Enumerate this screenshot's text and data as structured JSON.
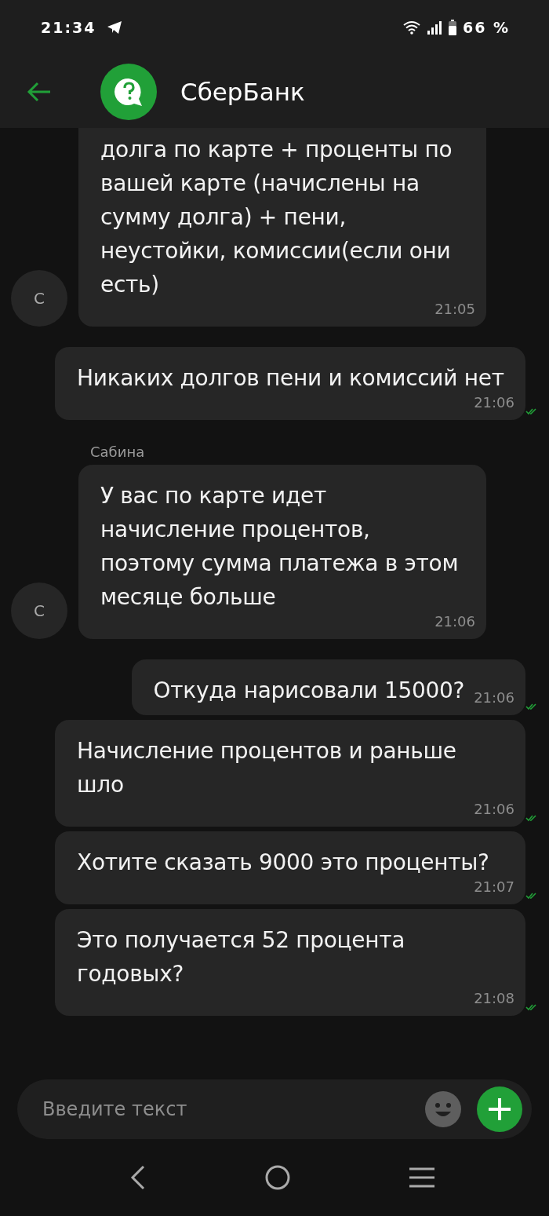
{
  "status_bar": {
    "time": "21:34",
    "battery": "66 %"
  },
  "header": {
    "title": "СберБанк"
  },
  "messages": [
    {
      "kind": "incoming",
      "avatar": "С",
      "text": "долга по карте + проценты по вашей карте (начислены на сумму долга) + пени, неустойки, комиссии(если они есть)",
      "time": "21:05"
    },
    {
      "kind": "outgoing",
      "text": "Никаких долгов пени и комиссий нет",
      "time": "21:06",
      "read": true
    },
    {
      "kind": "incoming",
      "sender": "Сабина",
      "avatar": "С",
      "text": "У вас по карте идет начисление процентов, поэтому сумма платежа в этом месяце больше",
      "time": "21:06"
    },
    {
      "kind": "outgoing",
      "text": "Откуда нарисовали 15000?",
      "time": "21:06",
      "read": true
    },
    {
      "kind": "outgoing",
      "text": "Начисление процентов и раньше шло",
      "time": "21:06",
      "read": true
    },
    {
      "kind": "outgoing",
      "text": "Хотите сказать 9000 это проценты?",
      "time": "21:07",
      "read": true
    },
    {
      "kind": "outgoing",
      "text": "Это получается 52 процента годовых?",
      "time": "21:08",
      "read": true
    }
  ],
  "composer": {
    "placeholder": "Введите текст"
  }
}
